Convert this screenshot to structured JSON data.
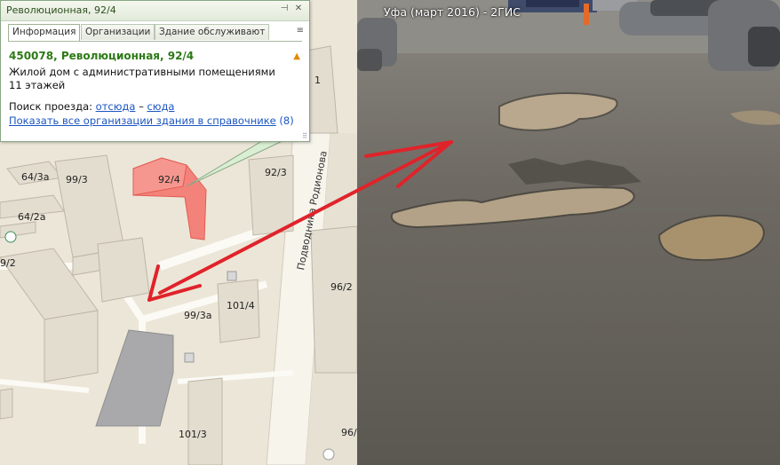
{
  "photo_caption": "Уфа (март 2016) - 2ГИС",
  "popup": {
    "title": "Революционная, 92/4",
    "pin_icon": "pin-icon",
    "close_icon": "close-icon",
    "tabs": [
      {
        "label": "Информация",
        "active": true
      },
      {
        "label": "Организации",
        "active": false
      },
      {
        "label": "Здание обслуживают",
        "active": false
      }
    ],
    "tabs_menu_icon": "menu-icon",
    "address": "450078, Революционная, 92/4",
    "description": "Жилой дом с административными помещениями",
    "floors": "11 этажей",
    "warning_icon": "warning-icon",
    "route_label": "Поиск проезда:",
    "route_from": "отсюда",
    "route_sep": "–",
    "route_to": "сюда",
    "show_orgs_link": "Показать все организации здания в справочнике",
    "orgs_count": "(8)"
  },
  "map": {
    "street": "Подводника Родионова",
    "labels": {
      "b_64_3a": "64/3а",
      "b_99_3": "99/3",
      "b_92_4": "92/4",
      "b_92_3": "92/3",
      "b_64_2a": "64/2а",
      "b_9_2": "9/2",
      "b_99_3a": "99/3а",
      "b_101_4": "101/4",
      "b_96_2": "96/2",
      "b_101_3": "101/3",
      "b_96": "96/",
      "b_1": "1"
    }
  },
  "colors": {
    "highlight_building": "#f3837a",
    "arrow": "#e0232a",
    "address_green": "#2d7a16",
    "link_blue": "#1b55c0"
  }
}
